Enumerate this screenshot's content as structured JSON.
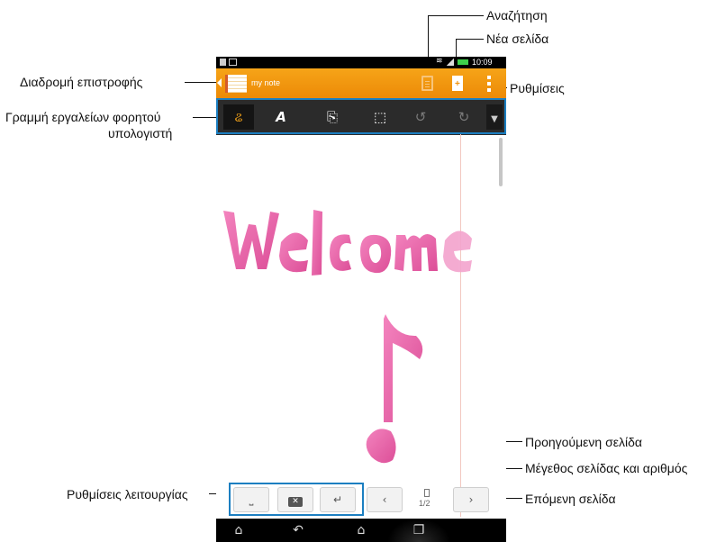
{
  "callouts": {
    "search": "Αναζήτηση",
    "new_page": "Νέα σελίδα",
    "back_path": "Διαδρομή επιστροφής",
    "settings": "Ρυθμίσεις",
    "toolbar_line1": "Γραμμή εργαλείων φορητού",
    "toolbar_line2": "υπολογιστή",
    "prev_page": "Προηγούμενη σελίδα",
    "page_size_number": "Μέγεθος σελίδας και αριθμός",
    "next_page": "Επόμενη σελίδα",
    "function_settings": "Ρυθμίσεις λειτουργίας"
  },
  "statusbar": {
    "time": "10:09"
  },
  "app": {
    "notebook_title": "my note"
  },
  "handwriting": {
    "word": "Welcome"
  },
  "pager": {
    "page_number": "1/2"
  },
  "colors": {
    "accent_orange": "#ef9310",
    "frame_blue": "#1c7fc1",
    "ink_pink": "#e8559f"
  },
  "icons": {
    "toolbar": [
      "pen-icon",
      "text-eraser-icon",
      "insert-icon",
      "select-hand-icon",
      "undo-icon",
      "redo-icon",
      "more-dropdown-icon"
    ],
    "nav": [
      "home-icon",
      "back-icon",
      "house-icon",
      "recent-apps-icon"
    ]
  }
}
